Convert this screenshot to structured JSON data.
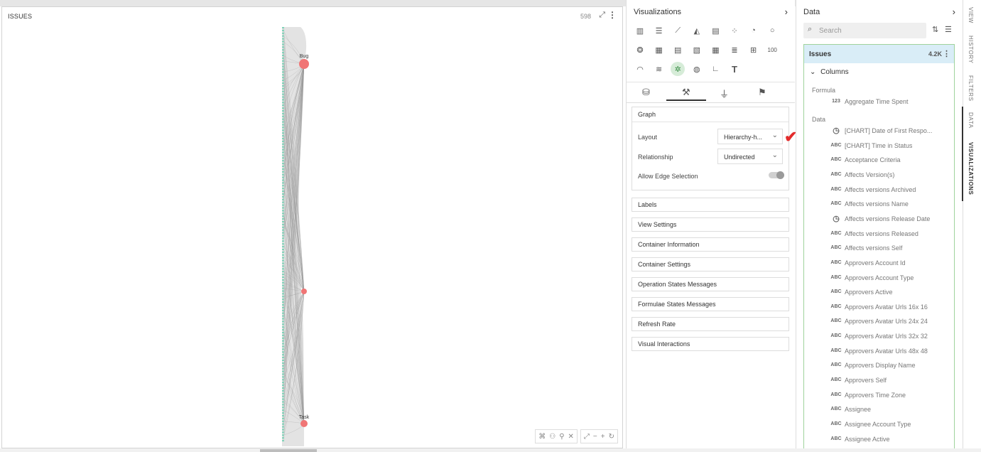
{
  "chart": {
    "title": "ISSUES",
    "count": "598",
    "expand_icon": "expand-icon",
    "more_icon": "more-vertical-icon",
    "nodes": [
      {
        "label": "Bug"
      },
      {
        "label": ""
      },
      {
        "label": "Task"
      }
    ],
    "node_color": "#f07575",
    "edge_color": "#9a9a9a",
    "leaf_color": "#7fd3b8"
  },
  "visualizations": {
    "title": "Visualizations",
    "chevron_icon": "chevron-right-icon",
    "types": [
      "column-chart-icon",
      "bar-chart-icon",
      "line-chart-icon",
      "area-chart-icon",
      "stacked-column-icon",
      "scatter-icon",
      "pie-icon",
      "donut-icon",
      "bubble-icon",
      "pivot-icon",
      "table-icon",
      "crosstab-icon",
      "grid-icon",
      "list-icon",
      "tiles-icon",
      "kpi-100-icon",
      "gauge-icon",
      "sankey-icon",
      "network-graph-icon",
      "globe-map-icon",
      "axis-icon",
      "text-icon"
    ],
    "kpi_label": "100",
    "text_label": "T",
    "active_type": "network-graph-icon",
    "tabs": [
      "data-source-icon",
      "format-paint-icon",
      "filter-icon",
      "palette-icon"
    ],
    "active_tab": 1,
    "graph_section": {
      "title": "Graph",
      "layout_label": "Layout",
      "layout_value": "Hierarchy-h...",
      "relationship_label": "Relationship",
      "relationship_value": "Undirected",
      "edge_selection_label": "Allow Edge Selection"
    },
    "sections": [
      "Labels",
      "View Settings",
      "Container Information",
      "Container Settings",
      "Operation States Messages",
      "Formulae States Messages",
      "Refresh Rate",
      "Visual Interactions"
    ]
  },
  "data_panel": {
    "title": "Data",
    "search_placeholder": "Search",
    "dataset": "Issues",
    "dataset_count": "4.2K",
    "columns_label": "Columns",
    "formula_group": "Formula",
    "formula_fields": [
      {
        "type": "123",
        "name": "Aggregate Time Spent"
      }
    ],
    "data_group": "Data",
    "data_fields": [
      {
        "type": "clock",
        "name": "[CHART] Date of First Respo..."
      },
      {
        "type": "ABC",
        "name": "[CHART] Time in Status"
      },
      {
        "type": "ABC",
        "name": "Acceptance Criteria"
      },
      {
        "type": "ABC",
        "name": "Affects Version(s)"
      },
      {
        "type": "ABC",
        "name": "Affects versions Archived"
      },
      {
        "type": "ABC",
        "name": "Affects versions Name"
      },
      {
        "type": "clock",
        "name": "Affects versions Release Date"
      },
      {
        "type": "ABC",
        "name": "Affects versions Released"
      },
      {
        "type": "ABC",
        "name": "Affects versions Self"
      },
      {
        "type": "ABC",
        "name": "Approvers Account Id"
      },
      {
        "type": "ABC",
        "name": "Approvers Account Type"
      },
      {
        "type": "ABC",
        "name": "Approvers Active"
      },
      {
        "type": "ABC",
        "name": "Approvers Avatar Urls 16x 16"
      },
      {
        "type": "ABC",
        "name": "Approvers Avatar Urls 24x 24"
      },
      {
        "type": "ABC",
        "name": "Approvers Avatar Urls 32x 32"
      },
      {
        "type": "ABC",
        "name": "Approvers Avatar Urls 48x 48"
      },
      {
        "type": "ABC",
        "name": "Approvers Display Name"
      },
      {
        "type": "ABC",
        "name": "Approvers Self"
      },
      {
        "type": "ABC",
        "name": "Approvers Time Zone"
      },
      {
        "type": "ABC",
        "name": "Assignee"
      },
      {
        "type": "ABC",
        "name": "Assignee Account Type"
      },
      {
        "type": "ABC",
        "name": "Assignee Active"
      }
    ]
  },
  "side_tabs": [
    "VIEW",
    "HISTORY",
    "FILTERS",
    "DATA",
    "VISUALIZATIONS"
  ],
  "active_side_tab": "VISUALIZATIONS"
}
